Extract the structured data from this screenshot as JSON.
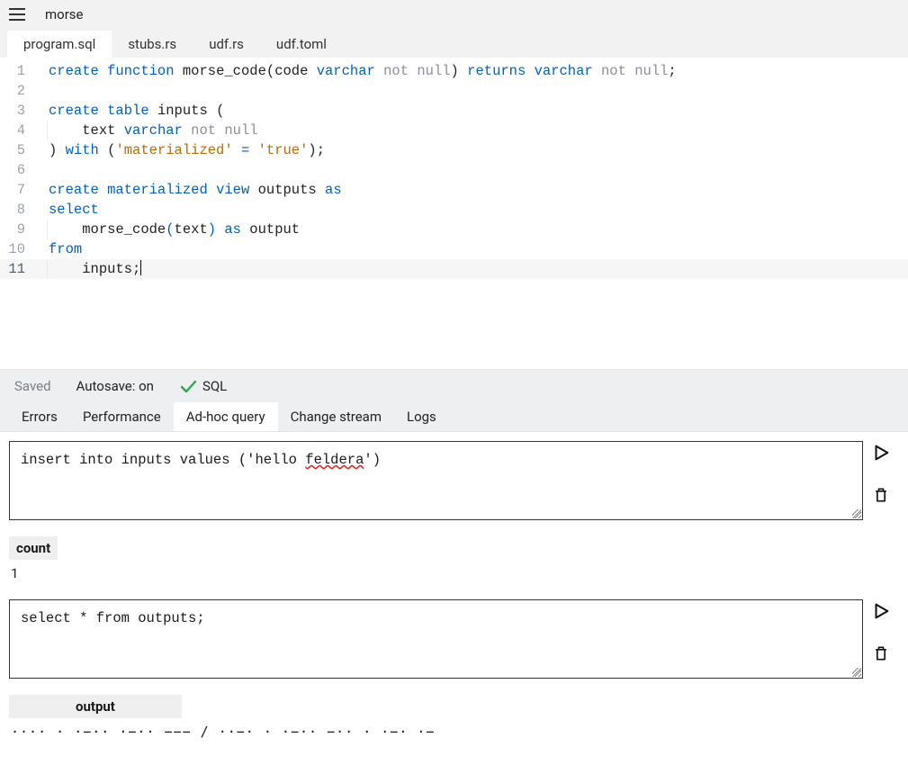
{
  "header": {
    "title": "morse"
  },
  "file_tabs": [
    {
      "label": "program.sql",
      "active": true
    },
    {
      "label": "stubs.rs",
      "active": false
    },
    {
      "label": "udf.rs",
      "active": false
    },
    {
      "label": "udf.toml",
      "active": false
    }
  ],
  "code": {
    "l1": {
      "kw1": "create",
      "kw2": "function",
      "fn": "morse_code",
      "p1": "(",
      "arg": "code ",
      "ty": "varchar",
      "mod": " not null",
      "p2": ")",
      "kw3": " returns ",
      "ty2": "varchar",
      "mod2": " not null",
      "end": ";"
    },
    "l2": "",
    "l3": {
      "kw1": "create",
      "kw2": "table",
      "nm": "inputs",
      "p": " ("
    },
    "l4": {
      "indent": "    ",
      "nm": "text ",
      "ty": "varchar",
      "mod": " not null"
    },
    "l5": {
      "p1": ") ",
      "kw": "with",
      "p2": " (",
      "s1": "'materialized'",
      "eq": " = ",
      "s2": "'true'",
      "p3": ");"
    },
    "l6": "",
    "l7": {
      "kw1": "create",
      "kw2": "materialized",
      "kw3": "view",
      "nm": "outputs",
      "kw4": "as"
    },
    "l8": {
      "kw": "select"
    },
    "l9": {
      "indent": "    ",
      "fn": "morse_code",
      "p1": "(",
      "arg": "text",
      "p2": ")",
      "kw": " as ",
      "nm": "output"
    },
    "l10": {
      "kw": "from"
    },
    "l11": {
      "indent": "    ",
      "nm": "inputs",
      "end": ";"
    }
  },
  "status": {
    "saved": "Saved",
    "autosave": "Autosave: on",
    "sql": "SQL"
  },
  "bottom_tabs": [
    {
      "label": "Errors",
      "active": false
    },
    {
      "label": "Performance",
      "active": false
    },
    {
      "label": "Ad-hoc query",
      "active": true
    },
    {
      "label": "Change stream",
      "active": false
    },
    {
      "label": "Logs",
      "active": false
    }
  ],
  "queries": {
    "q1": {
      "pre": "insert into inputs values ('hello ",
      "spell": "feldera",
      "post": "')"
    },
    "q2": "select * from outputs;"
  },
  "results": {
    "r1": {
      "header": "count",
      "value": "1"
    },
    "r2": {
      "header": "output",
      "value": "···· · ·−·· ·−·· −−− / ··−· · ·−·· −·· · ·−· ·−"
    }
  }
}
